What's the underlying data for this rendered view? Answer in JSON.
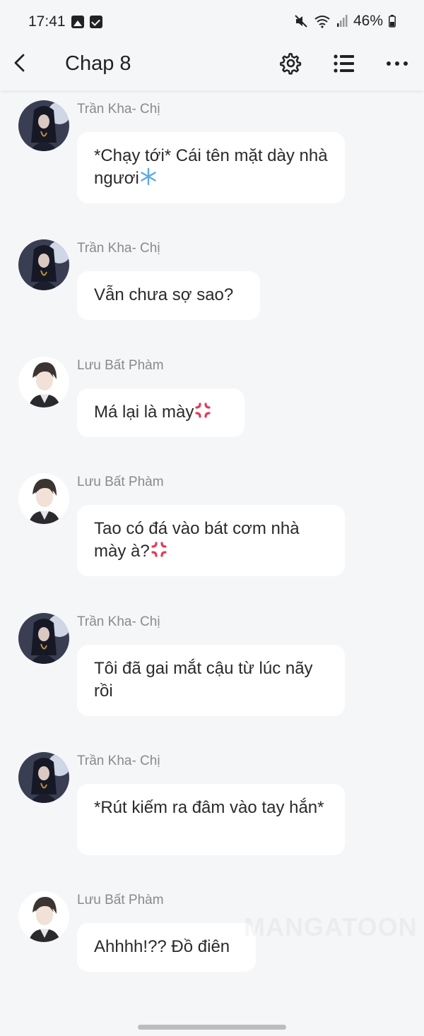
{
  "status_bar": {
    "time": "17:41",
    "battery": "46%",
    "icons": [
      "gallery-icon",
      "checkbox-icon",
      "mute-icon",
      "wifi-icon",
      "signal-icon",
      "battery-icon"
    ]
  },
  "toolbar": {
    "title": "Chap 8",
    "icons": [
      "back-icon",
      "gear-icon",
      "list-icon",
      "more-icon"
    ]
  },
  "messages": [
    {
      "sender": "Trần Kha- Chị",
      "text": "*Chạy tới* Cái tên mặt dày nhà ngươi",
      "emoji": "snowflake",
      "avatar": "dark"
    },
    {
      "sender": "Trần Kha- Chị",
      "text": "Vẫn chưa sợ sao?",
      "emoji": "",
      "avatar": "dark"
    },
    {
      "sender": "Lưu Bất Phàm",
      "text": "Má lại là mày",
      "emoji": "anger",
      "avatar": "light"
    },
    {
      "sender": "Lưu Bất Phàm",
      "text": "Tao có đá vào bát cơm nhà mày à?",
      "emoji": "anger",
      "avatar": "light"
    },
    {
      "sender": "Trần Kha- Chị",
      "text": "Tôi đã gai mắt cậu từ lúc nãy rồi",
      "emoji": "",
      "avatar": "dark"
    },
    {
      "sender": "Trần Kha- Chị",
      "text": "*Rút kiếm ra đâm vào tay hắn*",
      "emoji": "",
      "avatar": "dark"
    },
    {
      "sender": "Lưu Bất Phàm",
      "text": "Ahhhh!?? Đồ điên",
      "emoji": "",
      "avatar": "light"
    }
  ],
  "watermark": "MANGATOON",
  "colors": {
    "background": "#f5f6f8",
    "bubble": "#ffffff",
    "name": "#8a8a8a",
    "text": "#2a2a2a"
  }
}
